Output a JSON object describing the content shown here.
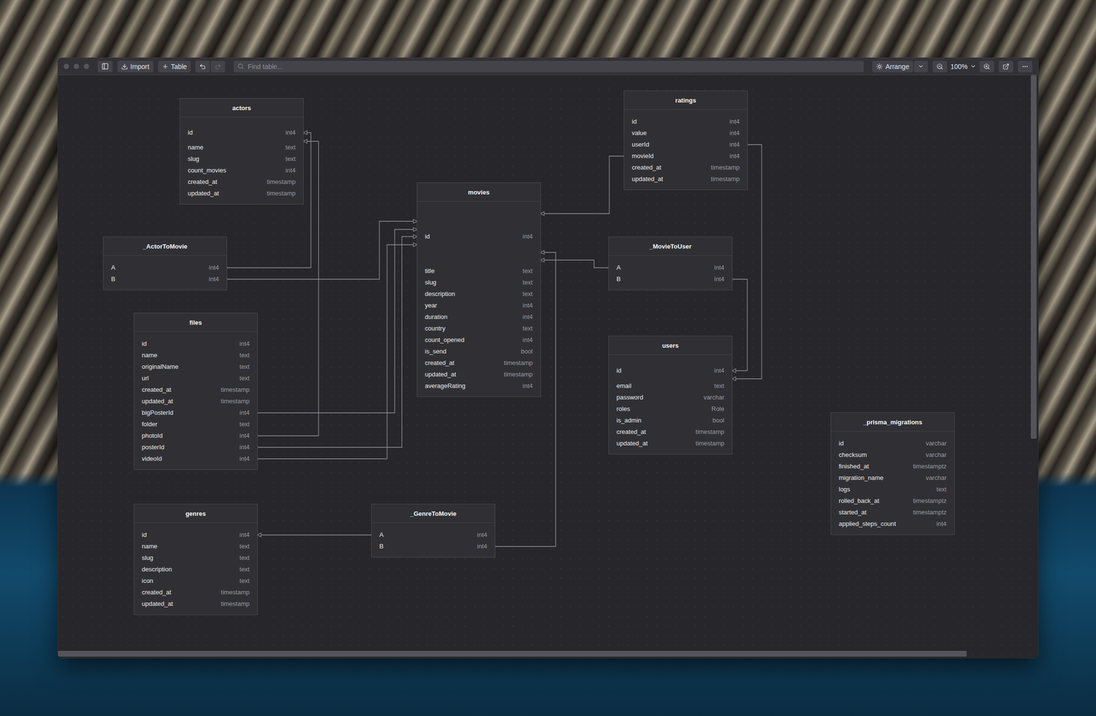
{
  "toolbar": {
    "import": "Import",
    "add_table": "Table",
    "undo": {
      "disabled": false
    },
    "redo": {
      "disabled": true
    },
    "search": {
      "placeholder": "Find table..."
    },
    "arrange": "Arrange",
    "zoom": "100%"
  },
  "tables": [
    {
      "name": "actors",
      "columns": [
        {
          "name": "id",
          "type": "int4"
        },
        {
          "name": "name",
          "type": "text"
        },
        {
          "name": "slug",
          "type": "text"
        },
        {
          "name": "count_movies",
          "type": "int4"
        },
        {
          "name": "created_at",
          "type": "timestamp"
        },
        {
          "name": "updated_at",
          "type": "timestamp"
        }
      ]
    },
    {
      "name": "_ActorToMovie",
      "columns": [
        {
          "name": "A",
          "type": "int4"
        },
        {
          "name": "B",
          "type": "int4"
        }
      ]
    },
    {
      "name": "files",
      "columns": [
        {
          "name": "id",
          "type": "int4"
        },
        {
          "name": "name",
          "type": "text"
        },
        {
          "name": "originalName",
          "type": "text"
        },
        {
          "name": "url",
          "type": "text"
        },
        {
          "name": "created_at",
          "type": "timestamp"
        },
        {
          "name": "updated_at",
          "type": "timestamp"
        },
        {
          "name": "bigPosterId",
          "type": "int4"
        },
        {
          "name": "folder",
          "type": "text"
        },
        {
          "name": "photoId",
          "type": "int4"
        },
        {
          "name": "posterId",
          "type": "int4"
        },
        {
          "name": "videoId",
          "type": "int4"
        }
      ]
    },
    {
      "name": "genres",
      "columns": [
        {
          "name": "id",
          "type": "int4"
        },
        {
          "name": "name",
          "type": "text"
        },
        {
          "name": "slug",
          "type": "text"
        },
        {
          "name": "description",
          "type": "text"
        },
        {
          "name": "icon",
          "type": "text"
        },
        {
          "name": "created_at",
          "type": "timestamp"
        },
        {
          "name": "updated_at",
          "type": "timestamp"
        }
      ]
    },
    {
      "name": "_GenreToMovie",
      "columns": [
        {
          "name": "A",
          "type": "int4"
        },
        {
          "name": "B",
          "type": "int4"
        }
      ]
    },
    {
      "name": "movies",
      "columns": [
        {
          "name": "id",
          "type": "int4"
        },
        {
          "name": "title",
          "type": "text"
        },
        {
          "name": "slug",
          "type": "text"
        },
        {
          "name": "description",
          "type": "text"
        },
        {
          "name": "year",
          "type": "int4"
        },
        {
          "name": "duration",
          "type": "int4"
        },
        {
          "name": "country",
          "type": "text"
        },
        {
          "name": "count_opened",
          "type": "int4"
        },
        {
          "name": "is_send",
          "type": "bool"
        },
        {
          "name": "created_at",
          "type": "timestamp"
        },
        {
          "name": "updated_at",
          "type": "timestamp"
        },
        {
          "name": "averageRating",
          "type": "int4"
        }
      ]
    },
    {
      "name": "ratings",
      "columns": [
        {
          "name": "id",
          "type": "int4"
        },
        {
          "name": "value",
          "type": "int4"
        },
        {
          "name": "userId",
          "type": "int4"
        },
        {
          "name": "movieId",
          "type": "int4"
        },
        {
          "name": "created_at",
          "type": "timestamp"
        },
        {
          "name": "updated_at",
          "type": "timestamp"
        }
      ]
    },
    {
      "name": "_MovieToUser",
      "columns": [
        {
          "name": "A",
          "type": "int4"
        },
        {
          "name": "B",
          "type": "int4"
        }
      ]
    },
    {
      "name": "users",
      "columns": [
        {
          "name": "id",
          "type": "int4"
        },
        {
          "name": "email",
          "type": "text"
        },
        {
          "name": "password",
          "type": "varchar"
        },
        {
          "name": "roles",
          "type": "Role"
        },
        {
          "name": "is_admin",
          "type": "bool"
        },
        {
          "name": "created_at",
          "type": "timestamp"
        },
        {
          "name": "updated_at",
          "type": "timestamp"
        }
      ]
    },
    {
      "name": "_prisma_migrations",
      "columns": [
        {
          "name": "id",
          "type": "varchar"
        },
        {
          "name": "checksum",
          "type": "varchar"
        },
        {
          "name": "finished_at",
          "type": "timestamptz"
        },
        {
          "name": "migration_name",
          "type": "varchar"
        },
        {
          "name": "logs",
          "type": "text"
        },
        {
          "name": "rolled_back_at",
          "type": "timestamptz"
        },
        {
          "name": "started_at",
          "type": "timestamptz"
        },
        {
          "name": "applied_steps_count",
          "type": "int4"
        }
      ]
    }
  ],
  "relations": [
    {
      "from": {
        "table": "_ActorToMovie",
        "column": "A"
      },
      "to": {
        "table": "actors",
        "column": "id"
      }
    },
    {
      "from": {
        "table": "files",
        "column": "photoId"
      },
      "to": {
        "table": "actors",
        "column": "id"
      }
    },
    {
      "from": {
        "table": "_ActorToMovie",
        "column": "B"
      },
      "to": {
        "table": "movies",
        "column": "id"
      }
    },
    {
      "from": {
        "table": "files",
        "column": "bigPosterId"
      },
      "to": {
        "table": "movies",
        "column": "id"
      }
    },
    {
      "from": {
        "table": "files",
        "column": "posterId"
      },
      "to": {
        "table": "movies",
        "column": "id"
      }
    },
    {
      "from": {
        "table": "files",
        "column": "videoId"
      },
      "to": {
        "table": "movies",
        "column": "id"
      }
    },
    {
      "from": {
        "table": "_GenreToMovie",
        "column": "A"
      },
      "to": {
        "table": "genres",
        "column": "id"
      }
    },
    {
      "from": {
        "table": "_GenreToMovie",
        "column": "B"
      },
      "to": {
        "table": "movies",
        "column": "id"
      }
    },
    {
      "from": {
        "table": "_MovieToUser",
        "column": "A"
      },
      "to": {
        "table": "movies",
        "column": "id"
      }
    },
    {
      "from": {
        "table": "ratings",
        "column": "movieId"
      },
      "to": {
        "table": "movies",
        "column": "id"
      }
    },
    {
      "from": {
        "table": "ratings",
        "column": "userId"
      },
      "to": {
        "table": "users",
        "column": "id"
      }
    },
    {
      "from": {
        "table": "_MovieToUser",
        "column": "B"
      },
      "to": {
        "table": "users",
        "column": "id"
      }
    }
  ]
}
